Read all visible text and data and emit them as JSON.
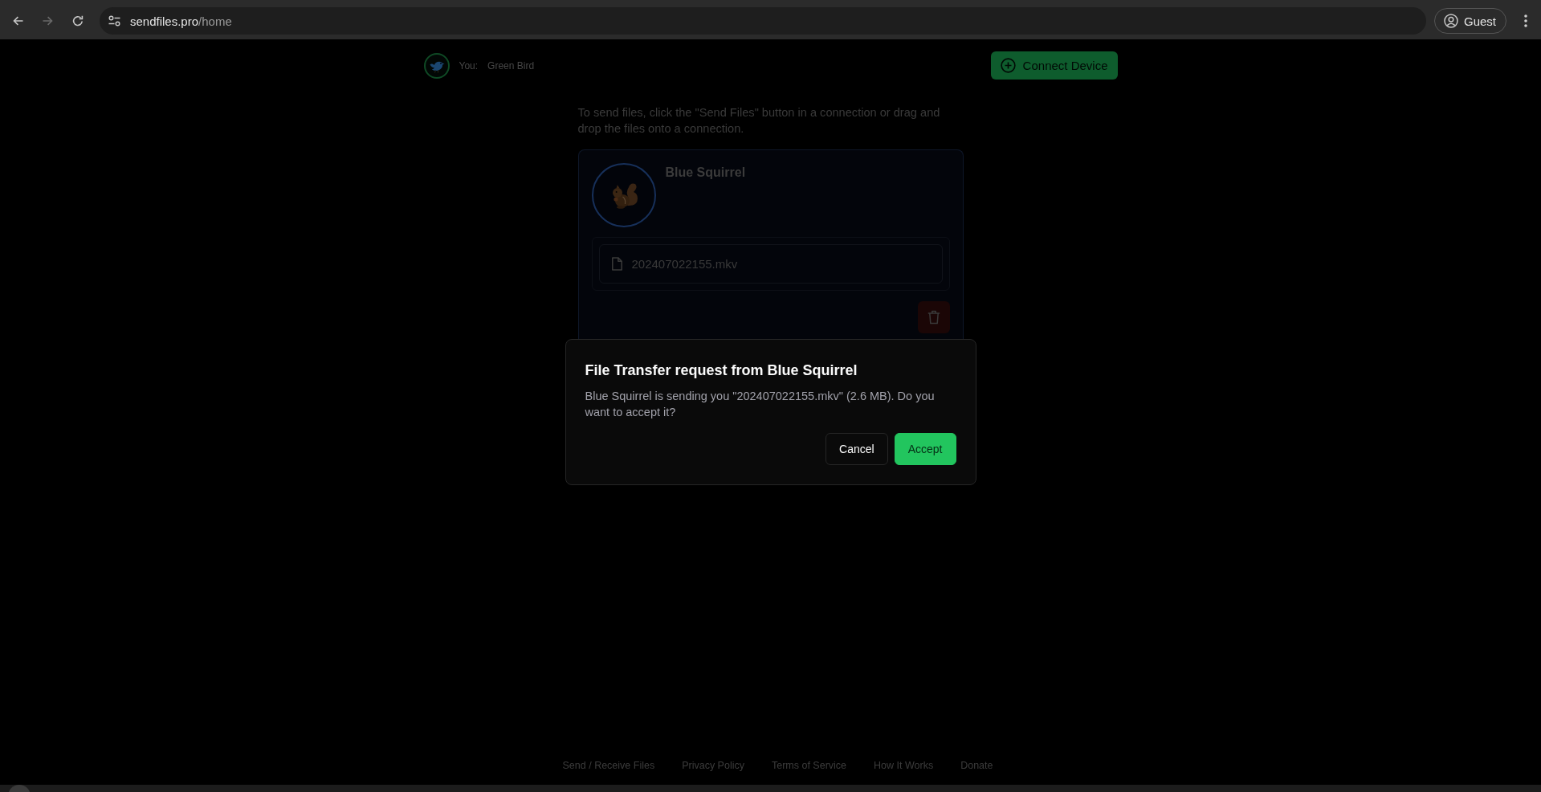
{
  "browser": {
    "nav": [
      {
        "kind": "back",
        "disabled": false
      },
      {
        "kind": "forward",
        "disabled": true
      },
      {
        "kind": "reload",
        "disabled": false
      }
    ],
    "url": {
      "host": "sendfiles.pro",
      "path": "/home"
    },
    "profile": "Guest"
  },
  "header": {
    "label": "You:",
    "device_name": "Green Bird",
    "connect_button": "Connect Device"
  },
  "instructions": "To send files, click the \"Send Files\" button in a connection or drag and drop the files onto a connection.",
  "connections": [
    {
      "name": "Blue Squirrel",
      "files": [
        "202407022155.mkv"
      ]
    }
  ],
  "dialog": {
    "title": "File Transfer request from Blue Squirrel",
    "message": "Blue Squirrel is sending you \"202407022155.mkv\" (2.6 MB). Do you want to accept it?",
    "buttons": [
      {
        "label": "Cancel",
        "kind": "secondary"
      },
      {
        "label": "Accept",
        "kind": "primary"
      }
    ]
  },
  "footer": {
    "links": [
      "Send / Receive Files",
      "Privacy Policy",
      "Terms of Service",
      "How It Works",
      "Donate"
    ]
  }
}
